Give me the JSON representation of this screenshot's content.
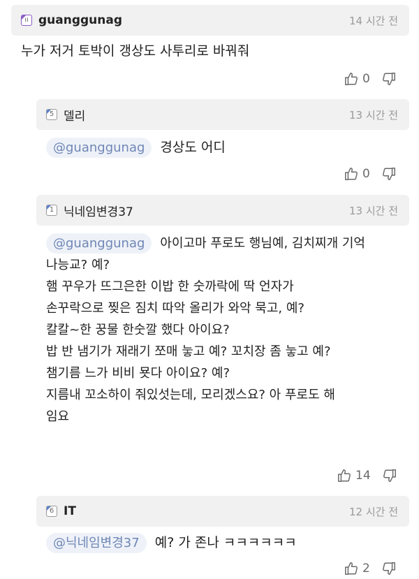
{
  "comments": [
    {
      "username": "guanggunag",
      "level_badge": "ıı",
      "time": "14 시간 전",
      "text": "누가 저거 토박이 갱상도 사투리로 바꿔줘",
      "likes": "0"
    },
    {
      "username": "델리",
      "level_badge": "5",
      "time": "13 시간 전",
      "mention": "@guanggunag",
      "text": "경상도 어디",
      "likes": "0"
    },
    {
      "username": "닉네임변경37",
      "level_badge": "1",
      "time": "13 시간 전",
      "mention": "@guanggunag",
      "lines": [
        "아이고마 푸로도 행님예, 김치찌개 기억",
        "나능교? 예?",
        "햄 꾸우가 뜨그은한 이밥 한 숫까락에 딱 언자가",
        "손꾸락으로 찢은 짐치 따악 올리가 와악 묵고, 예?",
        "칼칼~한 꿍물 한숫깔 했다 아이요?",
        "밥 반 냄기가 재래기 쪼매 눟고 예? 꼬치장 좀 눟고 예?",
        "챔기름 느가 비비 묫다 아이요? 예?",
        "지름내 꼬소하이 줘있섯는데, 모리겠스요? 아 푸로도 해",
        "임요"
      ],
      "likes": "14"
    },
    {
      "username": "IT",
      "level_badge": "6",
      "time": "12 시간 전",
      "mention": "@닉네임변경37",
      "text": "예? 가 존나 ㅋㅋㅋㅋㅋㅋ",
      "likes": "2"
    }
  ],
  "icons": {
    "like": "thumbs-up-icon",
    "dislike": "thumbs-down-icon"
  }
}
